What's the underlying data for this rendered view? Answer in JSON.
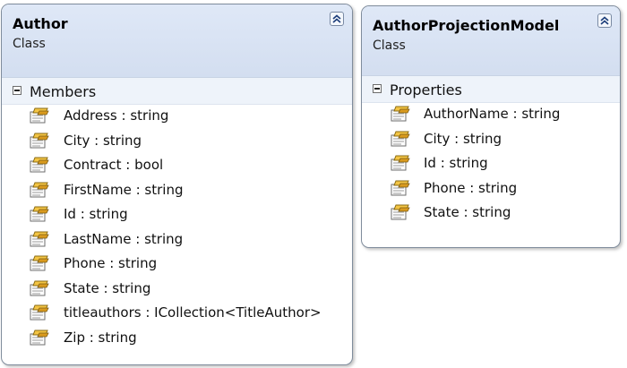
{
  "classes": [
    {
      "name": "Author",
      "kind": "Class",
      "section": "Members",
      "members": [
        "Address : string",
        "City : string",
        "Contract : bool",
        "FirstName : string",
        "Id : string",
        "LastName : string",
        "Phone : string",
        "State : string",
        "titleauthors : ICollection<TitleAuthor>",
        "Zip : string"
      ]
    },
    {
      "name": "AuthorProjectionModel",
      "kind": "Class",
      "section": "Properties",
      "members": [
        "AuthorName : string",
        "City : string",
        "Id : string",
        "Phone : string",
        "State : string"
      ]
    }
  ],
  "icons": {
    "collapse": "double-chevron-up-icon",
    "property": "property-icon",
    "section_toggle": "minus-icon"
  },
  "colors": {
    "header_bg": "#d9e3f4",
    "section_bg": "#eef3fa",
    "border": "#7f8c9c"
  }
}
